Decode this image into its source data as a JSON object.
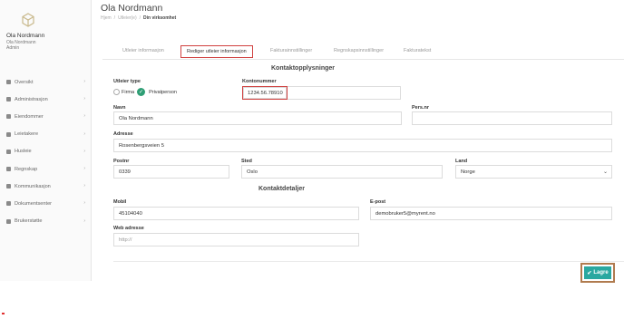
{
  "user": {
    "name": "Ola Nordmann",
    "sub1": "Ola Nordmann",
    "sub2": "Admin"
  },
  "nav": [
    {
      "label": "Oversikt",
      "icon": "home-icon"
    },
    {
      "label": "Administrasjon",
      "icon": "users-icon"
    },
    {
      "label": "Eiendommer",
      "icon": "building-icon"
    },
    {
      "label": "Leietakere",
      "icon": "key-icon"
    },
    {
      "label": "Husleie",
      "icon": "document-icon"
    },
    {
      "label": "Regnskap",
      "icon": "chart-icon"
    },
    {
      "label": "Kommunikasjon",
      "icon": "chat-icon"
    },
    {
      "label": "Dokumentsenter",
      "icon": "file-icon"
    },
    {
      "label": "Brukerstøtte",
      "icon": "help-icon"
    }
  ],
  "header": {
    "title": "Ola Nordmann",
    "breadcrumb": [
      "Hjem",
      "/",
      "Utleier(e)",
      "/",
      "Din virksomhet"
    ]
  },
  "tabs": [
    "Utleier informasjon",
    "Rediger utleier informasjon",
    "Fakturainnstillinger",
    "Regnskapsinnstillinger",
    "Fakturatekst"
  ],
  "form": {
    "section1": "Kontaktopplysninger",
    "utleier_type_label": "Utleier type",
    "radio_firma": "Firma",
    "radio_privat": "Privatperson",
    "kontonummer_label": "Kontonummer",
    "kontonummer": "1234.56.78910",
    "navn_label": "Navn",
    "navn": "Ola Nordmann",
    "persnr_label": "Pers.nr",
    "persnr": "",
    "adresse_label": "Adresse",
    "adresse": "Rosenbergsveien 5",
    "postnr_label": "Postnr",
    "postnr": "0339",
    "sted_label": "Sted",
    "sted": "Oslo",
    "land_label": "Land",
    "land": "Norge",
    "section2": "Kontaktdetaljer",
    "mobil_label": "Mobil",
    "mobil": "45104040",
    "epost_label": "E-post",
    "epost": "demobruker5@myrent.no",
    "web_label": "Web adresse",
    "web_placeholder": "http://"
  },
  "save_label": "Lagre"
}
